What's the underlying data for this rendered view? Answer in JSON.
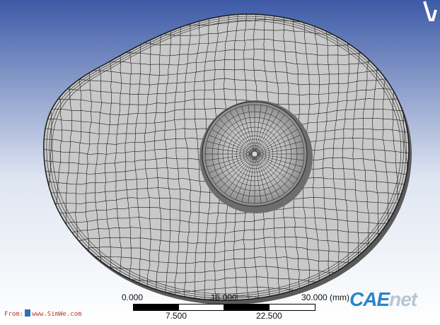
{
  "viewport": {
    "background_top": "#3d5aa6",
    "background_bottom": "#ffffff",
    "model_face_color": "#c9c9c9",
    "mesh_line_color": "#1a1a1a"
  },
  "triad_icon": "axis-triad-icon",
  "scale_bar": {
    "labels_top": [
      "0.000",
      "15.000",
      "30.000 (mm)"
    ],
    "labels_bottom": [
      "7.500",
      "22.500"
    ],
    "colors": [
      "#000000",
      "#ffffff",
      "#000000",
      "#ffffff"
    ]
  },
  "watermark": {
    "from_prefix": "From:",
    "from_site": "www.SimWe.com",
    "brand_part1": "CAE",
    "brand_part2": "net"
  }
}
